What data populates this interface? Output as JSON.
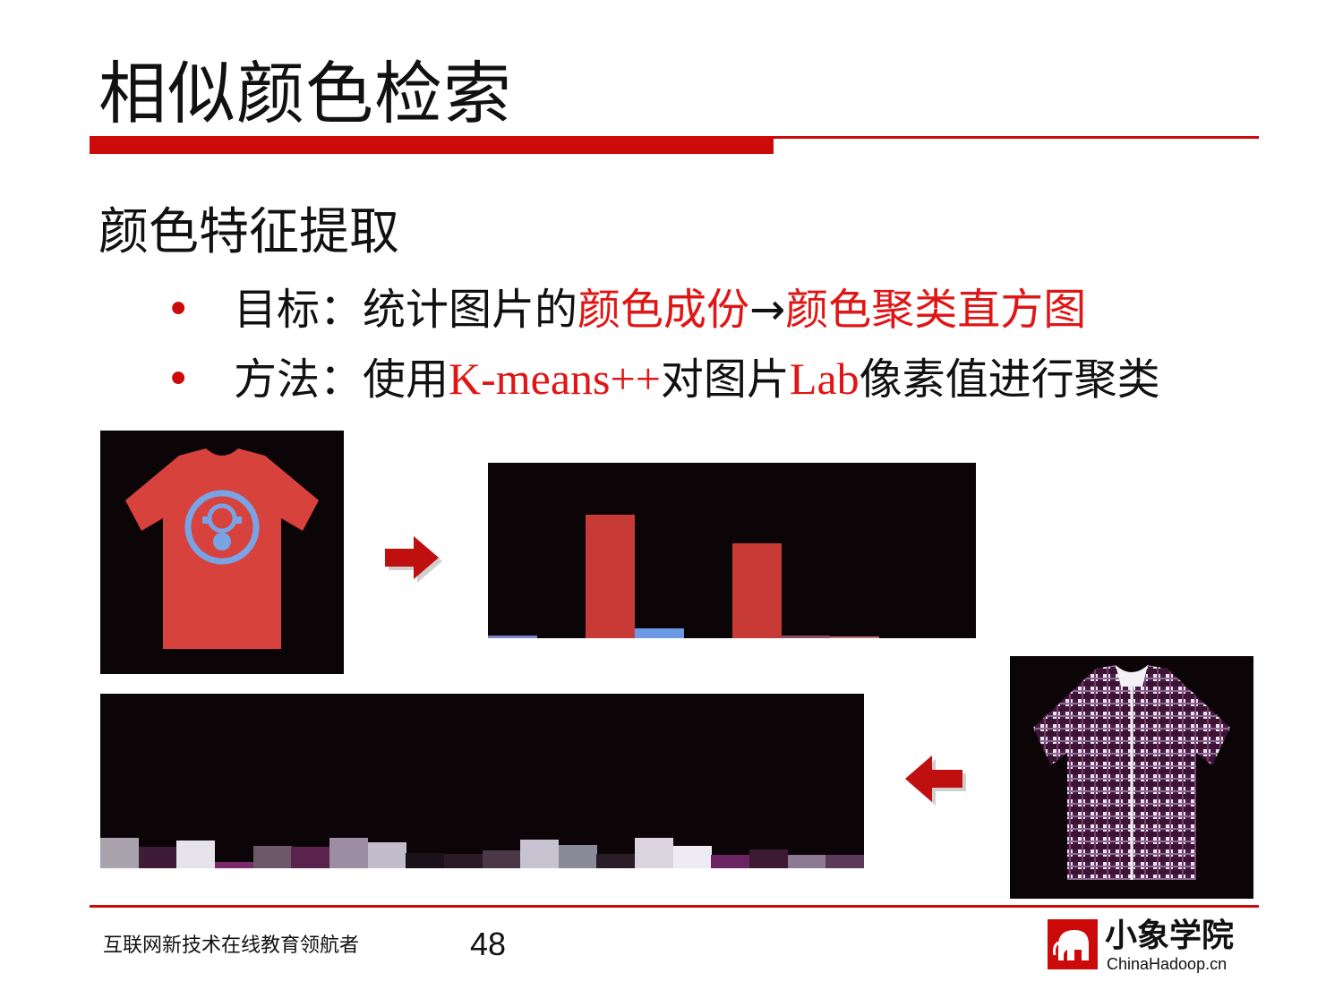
{
  "slide": {
    "title": "相似颜色检索",
    "subtitle": "颜色特征提取",
    "bullets": [
      {
        "bullet": "•",
        "parts": [
          {
            "text": "目标：统计图片的",
            "red": false,
            "latin": false
          },
          {
            "text": "颜色成份",
            "red": true,
            "latin": false
          },
          {
            "text": "→",
            "red": false,
            "latin": false
          },
          {
            "text": "颜色聚类直方图",
            "red": true,
            "latin": false
          }
        ]
      },
      {
        "bullet": "•",
        "parts": [
          {
            "text": "方法：使用",
            "red": false,
            "latin": false
          },
          {
            "text": "K-means++",
            "red": true,
            "latin": true
          },
          {
            "text": "对图片",
            "red": false,
            "latin": false
          },
          {
            "text": "Lab",
            "red": true,
            "latin": true
          },
          {
            "text": "像素值进行聚类",
            "red": false,
            "latin": false
          }
        ]
      }
    ]
  },
  "images": {
    "tshirt": {
      "icon": "red-tshirt-gasmask-icon"
    },
    "plaid_shirt": {
      "icon": "plaid-shirt-icon"
    },
    "arrow_right": {
      "icon": "arrow-right-icon"
    },
    "arrow_left": {
      "icon": "arrow-left-icon"
    }
  },
  "histogram_top": {
    "colors": [
      "#7d86c8",
      "#000000",
      "#c83a35",
      "#6b99e6",
      "#000000",
      "#c83a35",
      "#8a4f62",
      "#b87373",
      "#000000",
      "#000000"
    ],
    "values": [
      0.02,
      0,
      1.0,
      0.08,
      0,
      0.77,
      0.025,
      0.015,
      0.0,
      0.0
    ]
  },
  "histogram_bottom": {
    "colors": [
      "#a9a3ad",
      "#3e1b36",
      "#e6e4ea",
      "#7a2a6a",
      "#6c5868",
      "#5a234e",
      "#9d8da2",
      "#c3bccc",
      "#1b1118",
      "#2b1a26",
      "#4a3846",
      "#c8c3d0",
      "#8b8a98",
      "#2a1d27",
      "#d9d4de",
      "#eeecf2",
      "#6b2462",
      "#3b1a32",
      "#8c7a92",
      "#5a3a58"
    ],
    "values": [
      1.0,
      0.72,
      0.9,
      0.2,
      0.73,
      0.72,
      1.0,
      0.85,
      0.5,
      0.46,
      0.6,
      0.95,
      0.75,
      0.47,
      1.0,
      0.73,
      0.45,
      0.63,
      0.44,
      0.45
    ]
  },
  "footer": {
    "tagline": "互联网新技术在线教育领航者",
    "page": "48",
    "brand_cn": "小象学院",
    "brand_en": "ChinaHadoop.cn"
  },
  "colors": {
    "accent": "#cc0a0a",
    "emphasis": "#e01515"
  }
}
